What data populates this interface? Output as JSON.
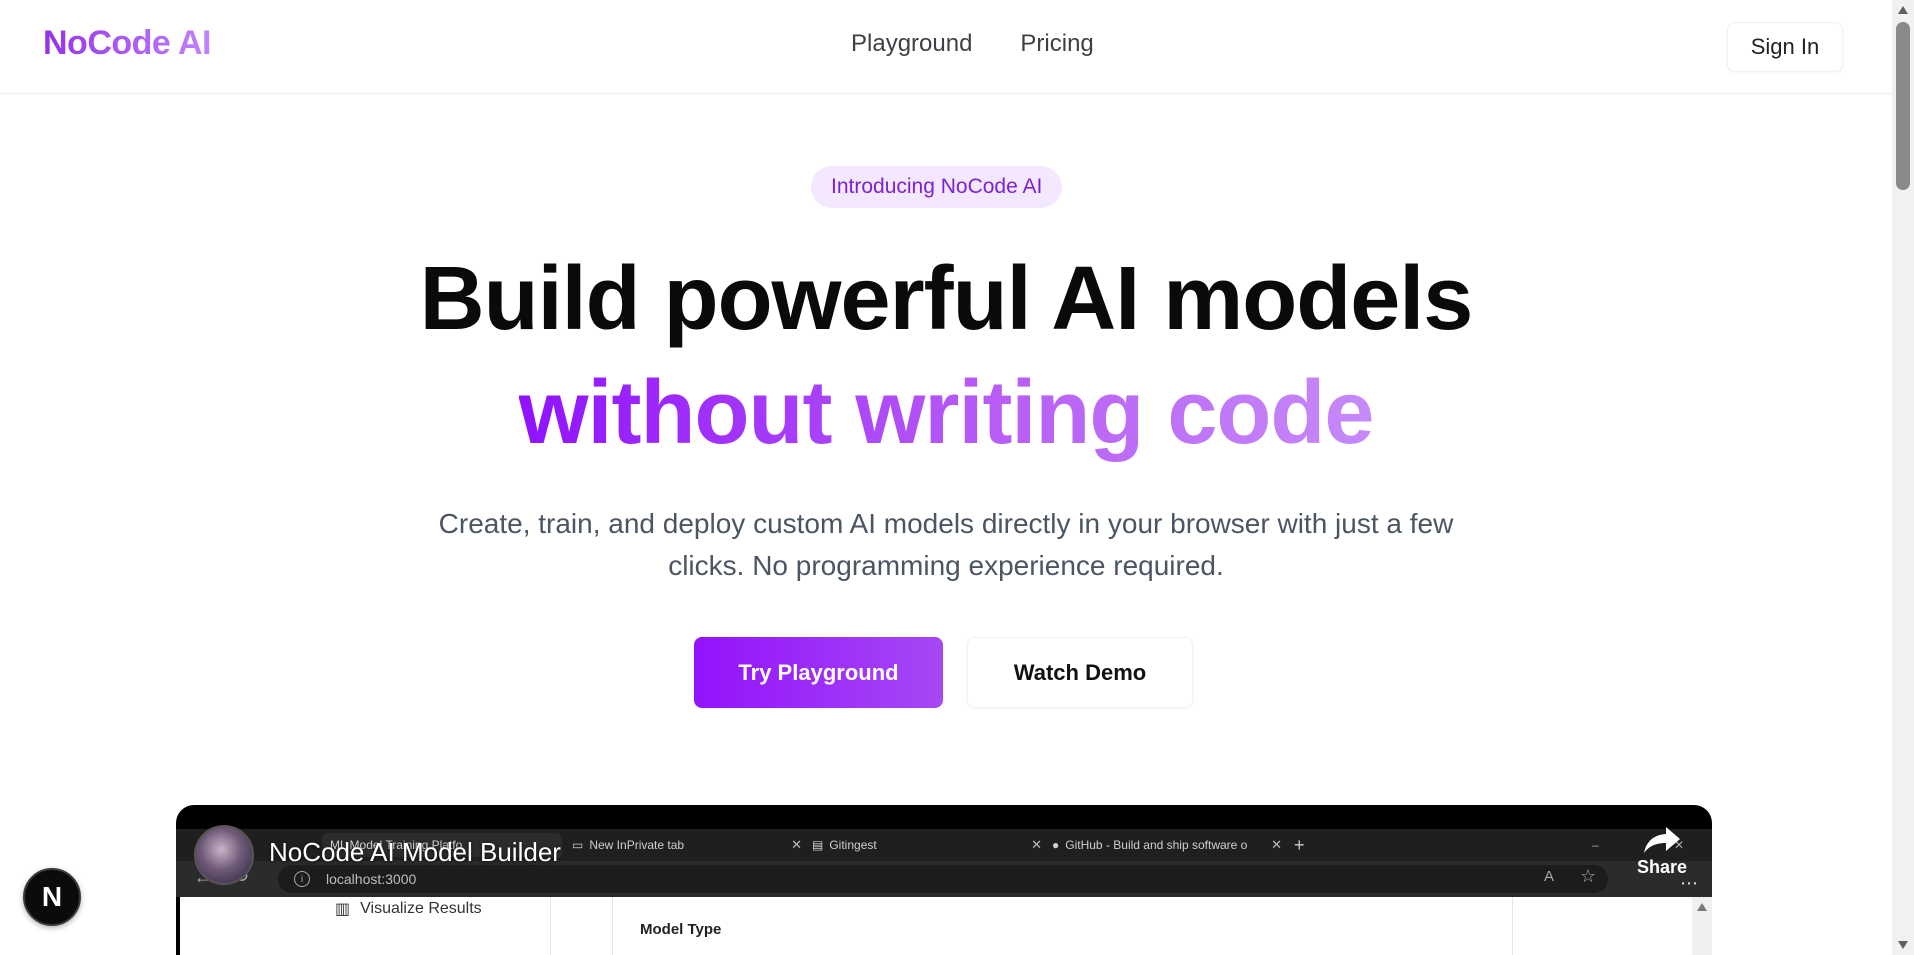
{
  "header": {
    "brand": "NoCode AI",
    "nav": [
      {
        "label": "Playground"
      },
      {
        "label": "Pricing"
      }
    ],
    "signin_label": "Sign In"
  },
  "hero": {
    "badge": "Introducing NoCode AI",
    "title_line1": "Build powerful AI models",
    "title_line2": "without writing code",
    "subtitle": "Create, train, and deploy custom AI models directly in your browser with just a few clicks. No programming experience required.",
    "primary_cta": "Try Playground",
    "secondary_cta": "Watch Demo"
  },
  "video": {
    "title": "NoCode AI Model Builder",
    "share_label": "Share",
    "tabs": [
      {
        "label": "ML Model Training Platfo",
        "active": true
      },
      {
        "label": "New InPrivate tab"
      },
      {
        "label": "Gitingest"
      },
      {
        "label": "GitHub - Build and ship software o"
      }
    ],
    "url": "localhost:3000",
    "sidebar_item": "Visualize Results",
    "section_label": "Model Type"
  },
  "floating_badge": "N",
  "colors": {
    "brand_gradient_start": "#9333ea",
    "brand_gradient_end": "#c084fc",
    "badge_bg": "#f3e8ff",
    "primary_button": "#9312fb"
  }
}
